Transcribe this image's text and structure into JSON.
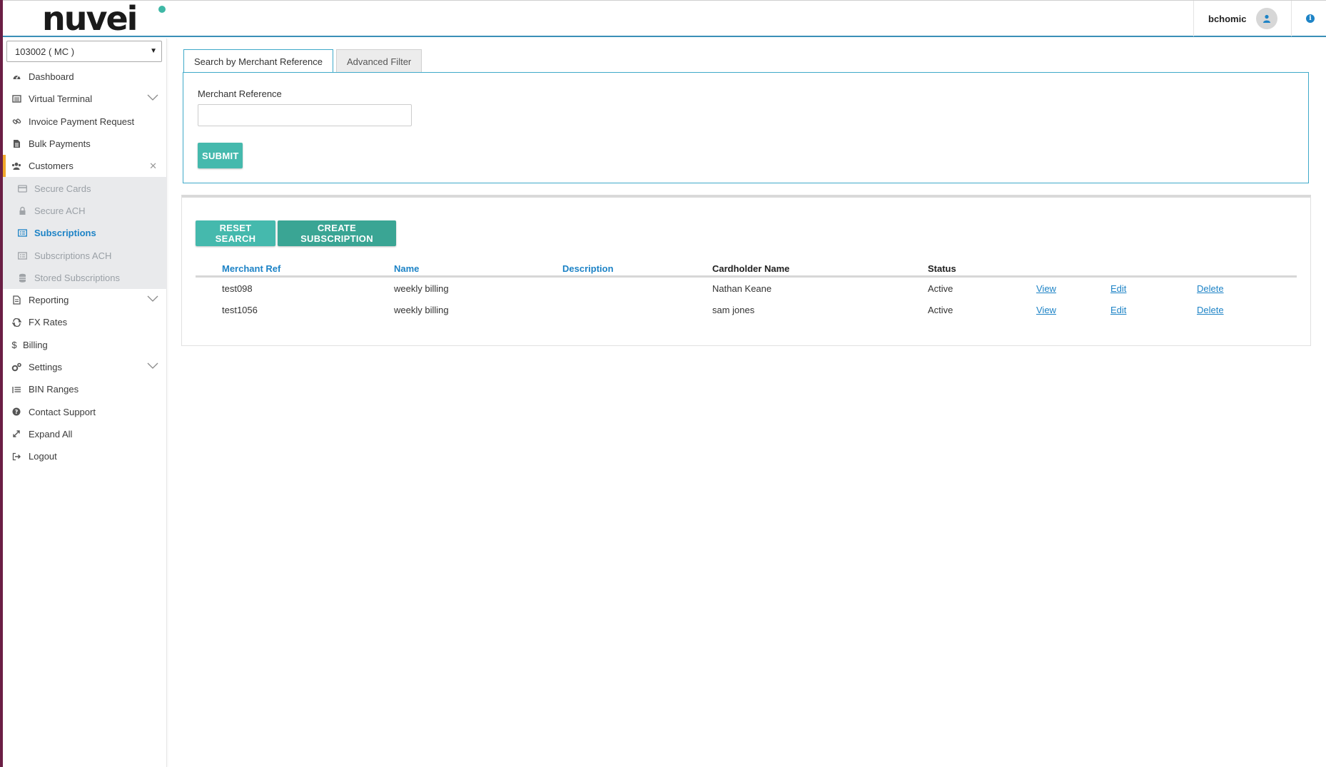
{
  "header": {
    "logo_text": "nuvei",
    "username": "bchomic",
    "brand_accent": "#3fb8a6",
    "link_color": "#1d83c6"
  },
  "sidebar": {
    "merchant_select": "103002 ( MC )",
    "items": [
      {
        "label": "Dashboard",
        "icon": "dashboard-icon"
      },
      {
        "label": "Virtual Terminal",
        "icon": "terminal-icon"
      },
      {
        "label": "Invoice Payment Request",
        "icon": "link-icon"
      },
      {
        "label": "Bulk Payments",
        "icon": "file-icon"
      },
      {
        "label": "Customers",
        "icon": "users-icon"
      },
      {
        "label": "Reporting",
        "icon": "report-icon"
      },
      {
        "label": "FX Rates",
        "icon": "exchange-icon"
      },
      {
        "label": "Billing",
        "icon": "dollar-icon"
      },
      {
        "label": "Settings",
        "icon": "cogs-icon"
      },
      {
        "label": "BIN Ranges",
        "icon": "list-icon"
      },
      {
        "label": "Contact Support",
        "icon": "question-icon"
      },
      {
        "label": "Expand All",
        "icon": "expand-icon"
      },
      {
        "label": "Logout",
        "icon": "logout-icon"
      }
    ],
    "customers_submenu": [
      {
        "label": "Secure Cards",
        "icon": "card-icon"
      },
      {
        "label": "Secure ACH",
        "icon": "lock-icon"
      },
      {
        "label": "Subscriptions",
        "icon": "subscriptions-icon"
      },
      {
        "label": "Subscriptions ACH",
        "icon": "subscriptions-ach-icon"
      },
      {
        "label": "Stored Subscriptions",
        "icon": "database-icon"
      }
    ]
  },
  "search": {
    "tabs": [
      "Search by Merchant Reference",
      "Advanced Filter"
    ],
    "field_label": "Merchant Reference",
    "field_value": "",
    "submit_label": "SUBMIT"
  },
  "results": {
    "reset_label": "RESET SEARCH",
    "create_label": "CREATE SUBSCRIPTION",
    "columns": [
      "Merchant Ref",
      "Name",
      "Description",
      "Cardholder Name",
      "Status"
    ],
    "rows": [
      {
        "merchant_ref": "test098",
        "name": "weekly billing",
        "description": "",
        "cardholder": "Nathan Keane",
        "status": "Active",
        "view": "View",
        "edit": "Edit",
        "delete": "Delete"
      },
      {
        "merchant_ref": "test1056",
        "name": "weekly billing",
        "description": "",
        "cardholder": "sam jones",
        "status": "Active",
        "view": "View",
        "edit": "Edit",
        "delete": "Delete"
      }
    ]
  }
}
